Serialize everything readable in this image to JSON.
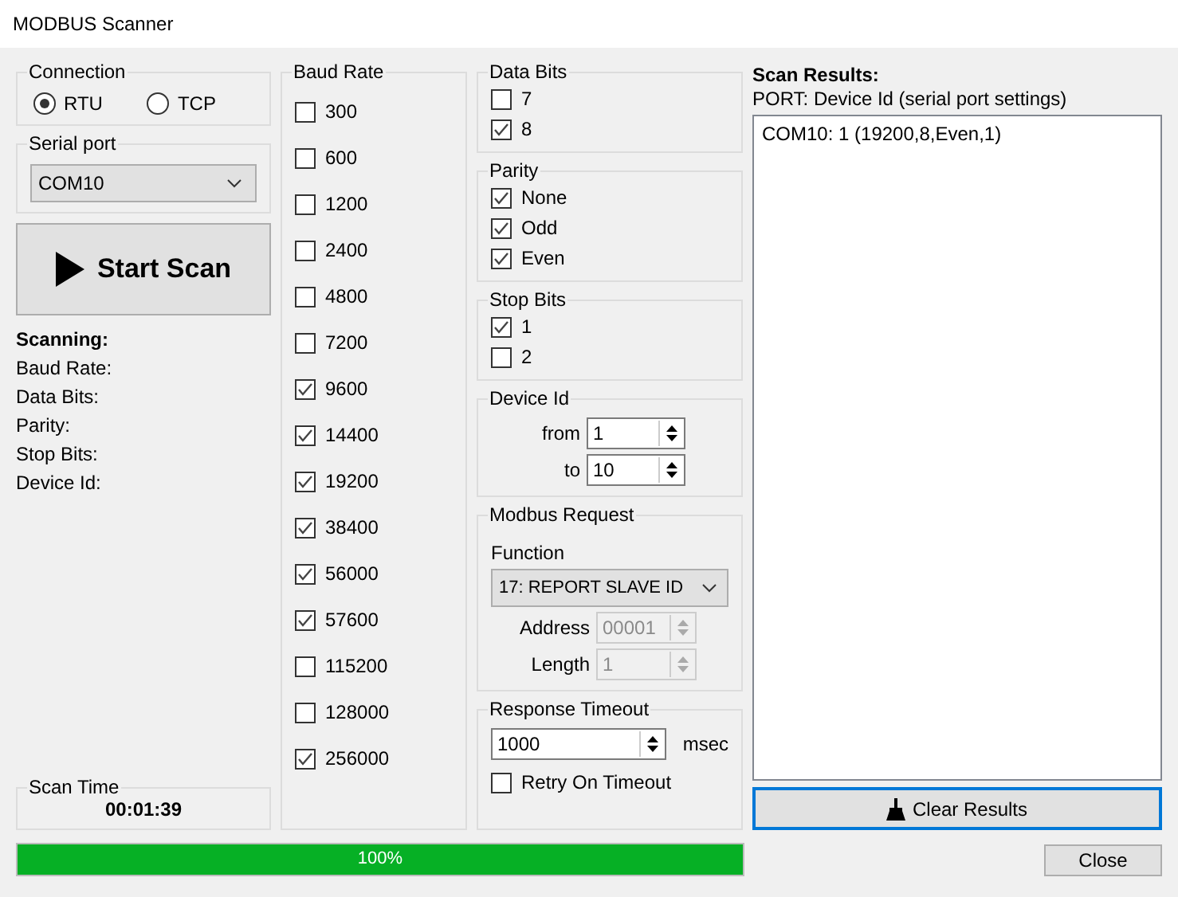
{
  "window": {
    "title": "MODBUS Scanner"
  },
  "connection": {
    "title": "Connection",
    "options": [
      {
        "label": "RTU",
        "selected": true
      },
      {
        "label": "TCP",
        "selected": false
      }
    ]
  },
  "serial_port": {
    "title": "Serial port",
    "value": "COM10"
  },
  "start_button": {
    "label": "Start Scan"
  },
  "scanning": {
    "title": "Scanning:",
    "fields": [
      "Baud Rate:",
      "Data Bits:",
      "Parity:",
      "Stop Bits:",
      "Device Id:"
    ]
  },
  "scan_time": {
    "title": "Scan Time",
    "value": "00:01:39"
  },
  "baud_rate": {
    "title": "Baud Rate",
    "items": [
      {
        "label": "300",
        "checked": false
      },
      {
        "label": "600",
        "checked": false
      },
      {
        "label": "1200",
        "checked": false
      },
      {
        "label": "2400",
        "checked": false
      },
      {
        "label": "4800",
        "checked": false
      },
      {
        "label": "7200",
        "checked": false
      },
      {
        "label": "9600",
        "checked": true
      },
      {
        "label": "14400",
        "checked": true
      },
      {
        "label": "19200",
        "checked": true
      },
      {
        "label": "38400",
        "checked": true
      },
      {
        "label": "56000",
        "checked": true
      },
      {
        "label": "57600",
        "checked": true
      },
      {
        "label": "115200",
        "checked": false
      },
      {
        "label": "128000",
        "checked": false
      },
      {
        "label": "256000",
        "checked": true
      }
    ]
  },
  "data_bits": {
    "title": "Data Bits",
    "items": [
      {
        "label": "7",
        "checked": false
      },
      {
        "label": "8",
        "checked": true
      }
    ]
  },
  "parity": {
    "title": "Parity",
    "items": [
      {
        "label": "None",
        "checked": true
      },
      {
        "label": "Odd",
        "checked": true
      },
      {
        "label": "Even",
        "checked": true
      }
    ]
  },
  "stop_bits": {
    "title": "Stop Bits",
    "items": [
      {
        "label": "1",
        "checked": true
      },
      {
        "label": "2",
        "checked": false
      }
    ]
  },
  "device_id": {
    "title": "Device Id",
    "fields": [
      {
        "label": "from",
        "value": "1"
      },
      {
        "label": "to",
        "value": "10"
      }
    ]
  },
  "modbus_request": {
    "title": "Modbus Request",
    "function_label": "Function",
    "function_value": "17: REPORT SLAVE ID",
    "fields": [
      {
        "label": "Address",
        "value": "00001",
        "disabled": true
      },
      {
        "label": "Length",
        "value": "1",
        "disabled": true
      }
    ]
  },
  "response_timeout": {
    "title": "Response Timeout",
    "value": "1000",
    "unit": "msec",
    "retry": {
      "label": "Retry On Timeout",
      "checked": false
    }
  },
  "progress": {
    "level": 1,
    "label": "100%"
  },
  "scan_results": {
    "title": "Scan Results:",
    "subtitle": "PORT: Device Id (serial port settings)",
    "rows": [
      "COM10: 1 (19200,8,Even,1)"
    ]
  },
  "clear_button": {
    "label": "Clear Results"
  },
  "close_button": {
    "label": "Close"
  }
}
